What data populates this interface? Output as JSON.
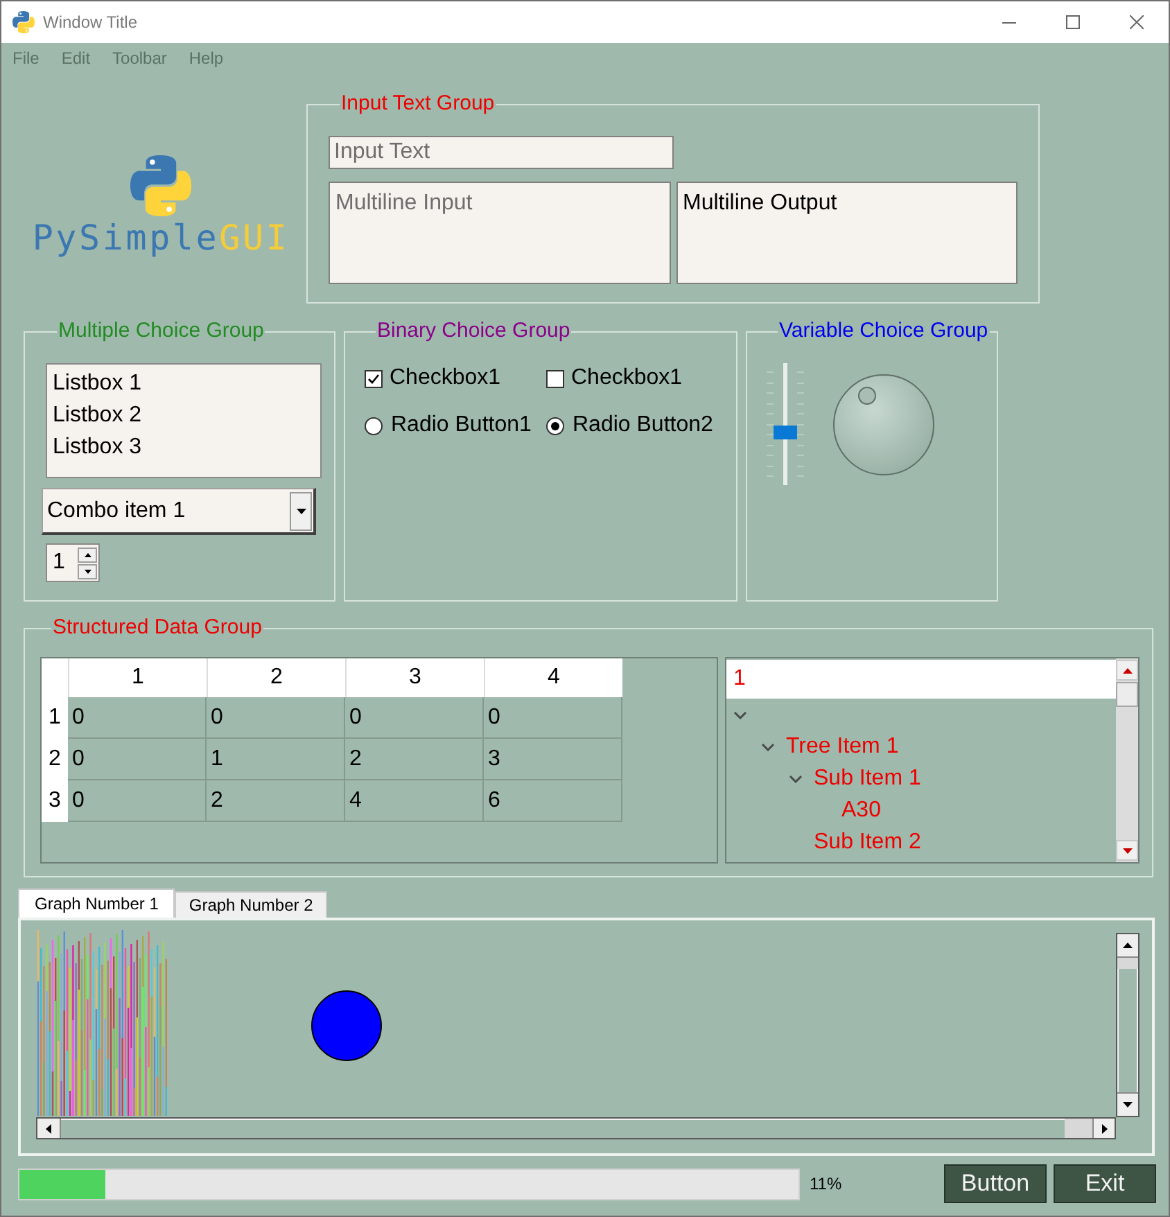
{
  "window": {
    "title": "Window Title"
  },
  "menu": [
    {
      "label": "File",
      "disabled": true
    },
    {
      "label": "Edit",
      "disabled": true
    },
    {
      "label": "Toolbar",
      "disabled": true
    },
    {
      "label": "Help",
      "disabled": true
    }
  ],
  "logo": {
    "wordmark": [
      "PySimple",
      "GUI"
    ]
  },
  "input_text_group": {
    "title": "Input Text Group",
    "input": {
      "placeholder": "Input Text"
    },
    "multiline_input": {
      "placeholder": "Multiline Input"
    },
    "multiline_output": {
      "value": "Multiline Output"
    }
  },
  "multiple_choice_group": {
    "title": "Multiple Choice Group",
    "listbox": [
      {
        "label": "Listbox 1",
        "selected": false
      },
      {
        "label": "Listbox 2",
        "selected": false
      },
      {
        "label": "Listbox 3",
        "selected": false
      }
    ],
    "combo": {
      "value": "Combo item 1"
    },
    "spin": {
      "value": "1"
    }
  },
  "binary_choice_group": {
    "title": "Binary Choice Group",
    "checkboxes": [
      {
        "label": "Checkbox1",
        "checked": true
      },
      {
        "label": "Checkbox1",
        "checked": false
      }
    ],
    "radios": [
      {
        "label": "Radio Button1",
        "selected": false
      },
      {
        "label": "Radio Button2",
        "selected": true
      }
    ]
  },
  "variable_choice_group": {
    "title": "Variable Choice Group",
    "slider": {
      "level": 0.42
    }
  },
  "structured_data_group": {
    "title": "Structured Data Group",
    "table": {
      "columns": [
        "1",
        "2",
        "3",
        "4"
      ],
      "rows": [
        {
          "header": "1",
          "cells": [
            "0",
            "0",
            "0",
            "0"
          ]
        },
        {
          "header": "2",
          "cells": [
            "0",
            "1",
            "2",
            "3"
          ]
        },
        {
          "header": "3",
          "cells": [
            "0",
            "2",
            "4",
            "6"
          ]
        }
      ]
    },
    "tree": {
      "heading": "1",
      "nodes": [
        {
          "expanded": true,
          "children": [
            {
              "text": "Tree Item 1",
              "expanded": true,
              "children": [
                {
                  "text": "Sub Item 1",
                  "expanded": true,
                  "children": [
                    {
                      "text": "A30"
                    }
                  ]
                },
                {
                  "text": "Sub Item 2"
                }
              ]
            }
          ]
        }
      ]
    }
  },
  "graph_tabs": [
    {
      "label": "Graph Number 1",
      "selected": true
    },
    {
      "label": "Graph Number 2",
      "selected": false
    }
  ],
  "progress": {
    "level": 0.11,
    "reading": "11%"
  },
  "buttons": [
    "Button",
    "Exit"
  ]
}
